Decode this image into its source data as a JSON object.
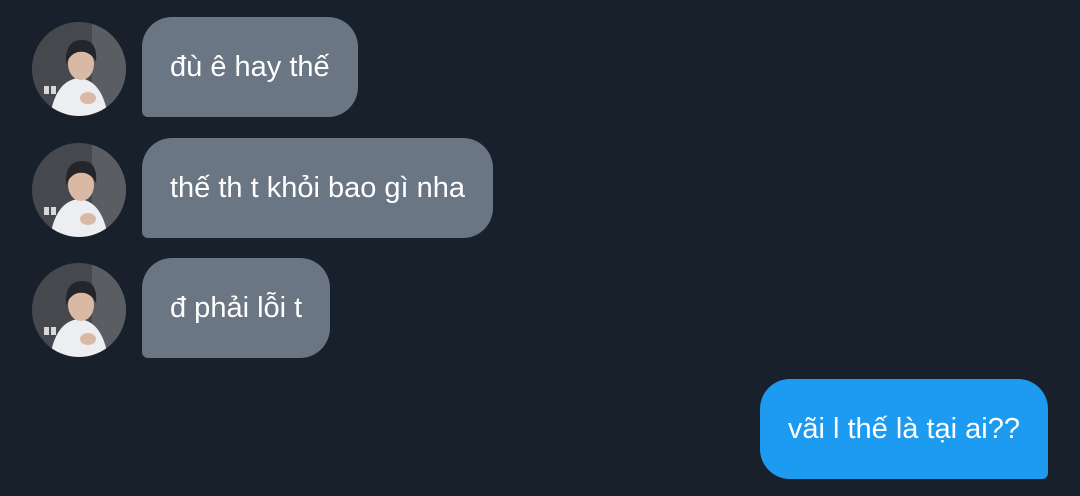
{
  "theme": {
    "background": "#18202b",
    "incoming_bubble": "#6a7684",
    "outgoing_bubble": "#1d9bf0",
    "text": "#ffffff"
  },
  "messages": [
    {
      "direction": "incoming",
      "text": "đù ê hay thế"
    },
    {
      "direction": "incoming",
      "text": "thế th t khỏi bao gì nha"
    },
    {
      "direction": "incoming",
      "text": "đ phải lỗi t"
    },
    {
      "direction": "outgoing",
      "text": "vãi l thế là tại ai??"
    }
  ],
  "avatar": {
    "icon": "user-photo-avatar"
  }
}
